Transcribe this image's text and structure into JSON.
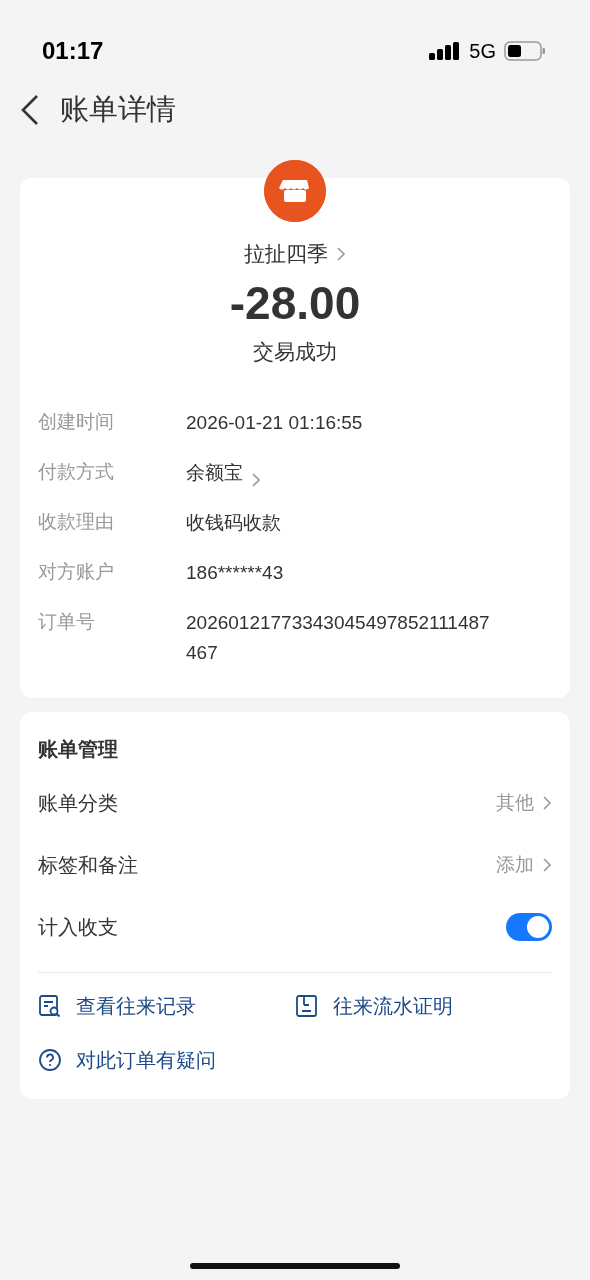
{
  "status_bar": {
    "time": "01:17",
    "network": "5G"
  },
  "header": {
    "title": "账单详情"
  },
  "merchant": {
    "name": "拉扯四季"
  },
  "amount": "-28.00",
  "status": "交易成功",
  "details": [
    {
      "label": "创建时间",
      "value": "2026-01-21 01:16:55",
      "link": false
    },
    {
      "label": "付款方式",
      "value": "余额宝",
      "link": true
    },
    {
      "label": "收款理由",
      "value": "收钱码收款",
      "link": false
    },
    {
      "label": "对方账户",
      "value": "186******43",
      "link": false
    },
    {
      "label": "订单号",
      "value": "20260121773343045497852111487467",
      "link": false
    }
  ],
  "management": {
    "title": "账单管理",
    "rows": [
      {
        "kind": "link",
        "label": "账单分类",
        "value": "其他"
      },
      {
        "kind": "link",
        "label": "标签和备注",
        "value": "添加"
      },
      {
        "kind": "toggle",
        "label": "计入收支",
        "on": true
      }
    ],
    "actions": [
      {
        "kind": "records",
        "label": "查看往来记录"
      },
      {
        "kind": "certificate",
        "label": "往来流水证明"
      },
      {
        "kind": "question",
        "label": "对此订单有疑问"
      }
    ]
  }
}
